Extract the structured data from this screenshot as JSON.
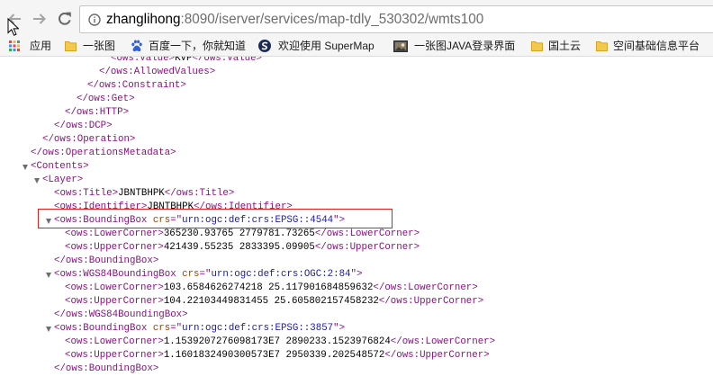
{
  "colors": {
    "tag": "#881280",
    "attr_name": "#994500",
    "attr_value": "#1a1aa6",
    "text": "#000000",
    "highlight": "#e0201b",
    "url_host": "#000000",
    "url_path": "#6d6d6d",
    "toolbar_bg": "#f5f5f5",
    "folder": "#f2c94c"
  },
  "icons": {
    "back": "back-arrow-icon",
    "forward": "forward-arrow-icon",
    "reload": "reload-icon",
    "site_info": "info-icon",
    "cursor": "mouse-cursor-icon",
    "expand": "expand-triangle-icon"
  },
  "toolbar": {
    "url_host": "zhanglihong",
    "url_path": ":8090/iserver/services/map-tdly_530302/wmts100"
  },
  "bookmarks": [
    {
      "label": "应用",
      "icon": "apps-grid-icon"
    },
    {
      "label": "一张图",
      "icon": "folder-icon"
    },
    {
      "label": "百度一下，你就知道",
      "icon": "baidu-paw-icon"
    },
    {
      "label": "欢迎使用 SuperMap",
      "icon": "supermap-logo-icon"
    },
    {
      "label": "一张图JAVA登录界面",
      "icon": "page-thumbnail-icon"
    },
    {
      "label": "国土云",
      "icon": "folder-icon"
    },
    {
      "label": "空间基础信息平台",
      "icon": "folder-icon"
    }
  ],
  "xml": {
    "lines": [
      {
        "open": "<ows:Value>",
        "text": "KVP",
        "close": "</ows:Value>"
      },
      {
        "close": "</ows:AllowedValues>"
      },
      {
        "close": "</ows:Constraint>"
      },
      {
        "close": "</ows:Get>"
      },
      {
        "close": "</ows:HTTP>"
      },
      {
        "close": "</ows:DCP>"
      },
      {
        "close": "</ows:Operation>"
      },
      {
        "close": "</ows:OperationsMetadata>"
      },
      {
        "open": "<Contents>"
      },
      {
        "open": "<Layer>"
      },
      {
        "open": "<ows:Title>",
        "text": "JBNTBHPK",
        "close": "</ows:Title>"
      },
      {
        "open": "<ows:Identifier>",
        "text": "JBNTBHPK",
        "close": "</ows:Identifier>"
      },
      {
        "open": "<ows:BoundingBox ",
        "attr": "crs",
        "eq": "=\"",
        "value": "urn:ogc:def:crs:EPSG::4544",
        "end": "\">"
      },
      {
        "open": "<ows:LowerCorner>",
        "text": "365230.93765 2779781.73265",
        "close": "</ows:LowerCorner>"
      },
      {
        "open": "<ows:UpperCorner>",
        "text": "421439.55235 2833395.09905",
        "close": "</ows:UpperCorner>"
      },
      {
        "close": "</ows:BoundingBox>"
      },
      {
        "open": "<ows:WGS84BoundingBox ",
        "attr": "crs",
        "eq": "=\"",
        "value": "urn:ogc:def:crs:OGC:2:84",
        "end": "\">"
      },
      {
        "open": "<ows:LowerCorner>",
        "text": "103.6584626274218 25.117901684859632",
        "close": "</ows:LowerCorner>"
      },
      {
        "open": "<ows:UpperCorner>",
        "text": "104.22103449831455 25.605802157458232",
        "close": "</ows:UpperCorner>"
      },
      {
        "close": "</ows:WGS84BoundingBox>"
      },
      {
        "open": "<ows:BoundingBox ",
        "attr": "crs",
        "eq": "=\"",
        "value": "urn:ogc:def:crs:EPSG::3857",
        "end": "\">"
      },
      {
        "open": "<ows:LowerCorner>",
        "text": "1.1539207276098173E7 2890233.1523976824",
        "close": "</ows:LowerCorner>"
      },
      {
        "open": "<ows:UpperCorner>",
        "text": "1.1601832490300573E7 2950339.202548572",
        "close": "</ows:UpperCorner>"
      },
      {
        "close": "</ows:BoundingBox>"
      }
    ]
  }
}
